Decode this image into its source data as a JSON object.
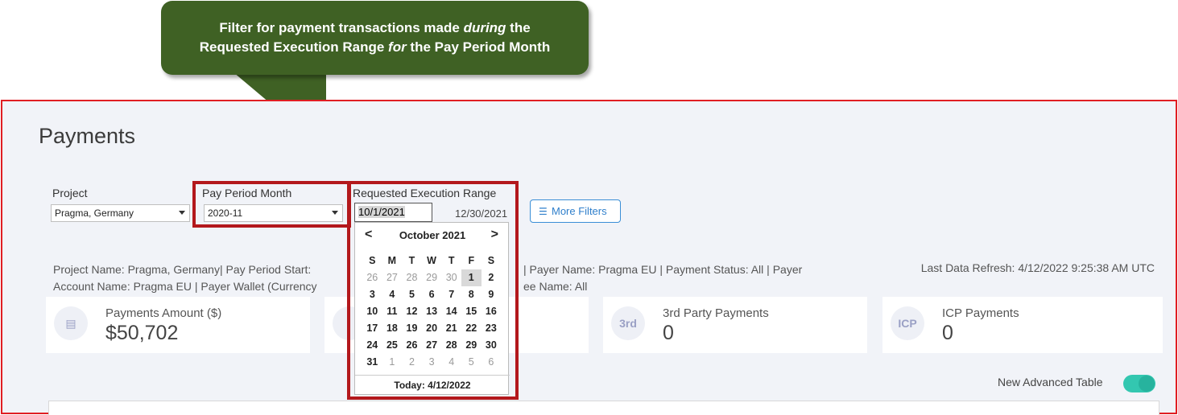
{
  "callout": {
    "line1_pre": "Filter for payment transactions made ",
    "line1_em": "during",
    "line1_post": " the",
    "line2_pre": "Requested Execution Range ",
    "line2_em": "for",
    "line2_post": " the Pay Period Month"
  },
  "page": {
    "title": "Payments"
  },
  "filters": {
    "project": {
      "label": "Project",
      "value": "Pragma, Germany"
    },
    "pay_period": {
      "label": "Pay Period Month",
      "value": "2020-11"
    },
    "execution_range": {
      "label": "Requested Execution Range",
      "start": "10/1/2021",
      "end": "12/30/2021"
    },
    "more_filters": {
      "label": "More Filters"
    }
  },
  "summary": {
    "line1_a": "Project Name: Pragma, Germany| Pay Period Start: ",
    "line1_b": "| Payer Name: Pragma EU | Payment Status: All | Payer",
    "line2_a": "Account Name: Pragma EU | Payer Wallet (Currency",
    "line2_b": "ee Name: All",
    "refresh": "Last Data Refresh: 4/12/2022 9:25:38 AM UTC"
  },
  "cards": [
    {
      "label": "Payments Amount ($)",
      "value": "$50,702",
      "icon": "money-icon",
      "icon_text": ""
    },
    {
      "label": "",
      "value": "",
      "icon": "people-icon",
      "icon_text": ""
    },
    {
      "label": "3rd Party Payments",
      "value": "0",
      "icon": "third-party-icon",
      "icon_text": "3rd"
    },
    {
      "label": "ICP Payments",
      "value": "0",
      "icon": "icp-icon",
      "icon_text": "ICP"
    }
  ],
  "toggle": {
    "label": "New Advanced Table",
    "on": true
  },
  "calendar": {
    "month": "October 2021",
    "prev": "<",
    "next": ">",
    "weekdays": [
      "S",
      "M",
      "T",
      "W",
      "T",
      "F",
      "S"
    ],
    "weeks": [
      [
        "26",
        "27",
        "28",
        "29",
        "30",
        "1",
        "2"
      ],
      [
        "3",
        "4",
        "5",
        "6",
        "7",
        "8",
        "9"
      ],
      [
        "10",
        "11",
        "12",
        "13",
        "14",
        "15",
        "16"
      ],
      [
        "17",
        "18",
        "19",
        "20",
        "21",
        "22",
        "23"
      ],
      [
        "24",
        "25",
        "26",
        "27",
        "28",
        "29",
        "30"
      ],
      [
        "31",
        "1",
        "2",
        "3",
        "4",
        "5",
        "6"
      ]
    ],
    "other_month": [
      [
        true,
        true,
        true,
        true,
        true,
        false,
        false
      ],
      [
        false,
        false,
        false,
        false,
        false,
        false,
        false
      ],
      [
        false,
        false,
        false,
        false,
        false,
        false,
        false
      ],
      [
        false,
        false,
        false,
        false,
        false,
        false,
        false
      ],
      [
        false,
        false,
        false,
        false,
        false,
        false,
        false
      ],
      [
        false,
        true,
        true,
        true,
        true,
        true,
        true
      ]
    ],
    "selected": "1",
    "today": "Today: 4/12/2022"
  },
  "colors": {
    "callout_bg": "#3f6124",
    "highlight_red": "#b3181c",
    "accent_blue": "#2f7fcb",
    "toggle_teal": "#33c7b0"
  }
}
